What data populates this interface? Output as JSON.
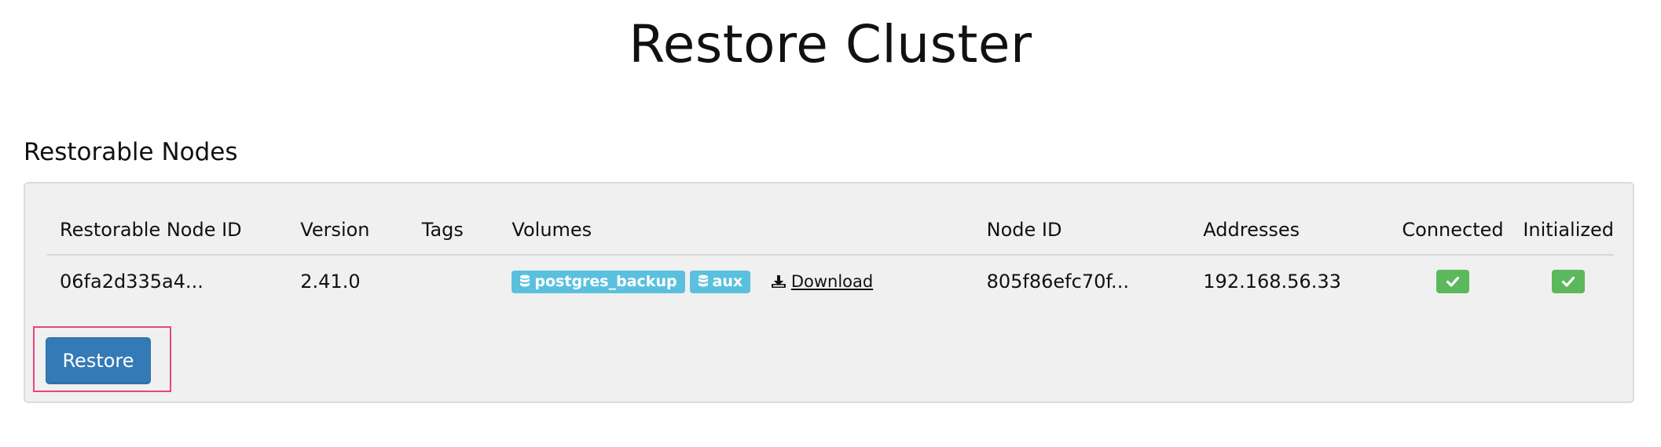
{
  "page": {
    "title": "Restore Cluster"
  },
  "section": {
    "title": "Restorable Nodes"
  },
  "table": {
    "columns": {
      "restorable_node_id": "Restorable Node ID",
      "version": "Version",
      "tags": "Tags",
      "volumes": "Volumes",
      "node_id": "Node ID",
      "addresses": "Addresses",
      "connected": "Connected",
      "initialized": "Initialized"
    },
    "rows": [
      {
        "restorable_node_id": "06fa2d335a4...",
        "version": "2.41.0",
        "tags": "",
        "volumes": [
          "postgres_backup",
          "aux"
        ],
        "download_label": "Download",
        "node_id": "805f86efc70f...",
        "addresses": "192.168.56.33",
        "connected": true,
        "initialized": true
      }
    ]
  },
  "actions": {
    "restore_label": "Restore"
  },
  "icons": {
    "volume": "database-icon",
    "download": "download-icon",
    "status": "check-icon"
  },
  "colors": {
    "volume_badge": "#5bc0de",
    "status_badge": "#5cb85c",
    "primary_button": "#337ab7",
    "focus_outline": "#e8457c",
    "panel_background": "#f0f0f0"
  }
}
